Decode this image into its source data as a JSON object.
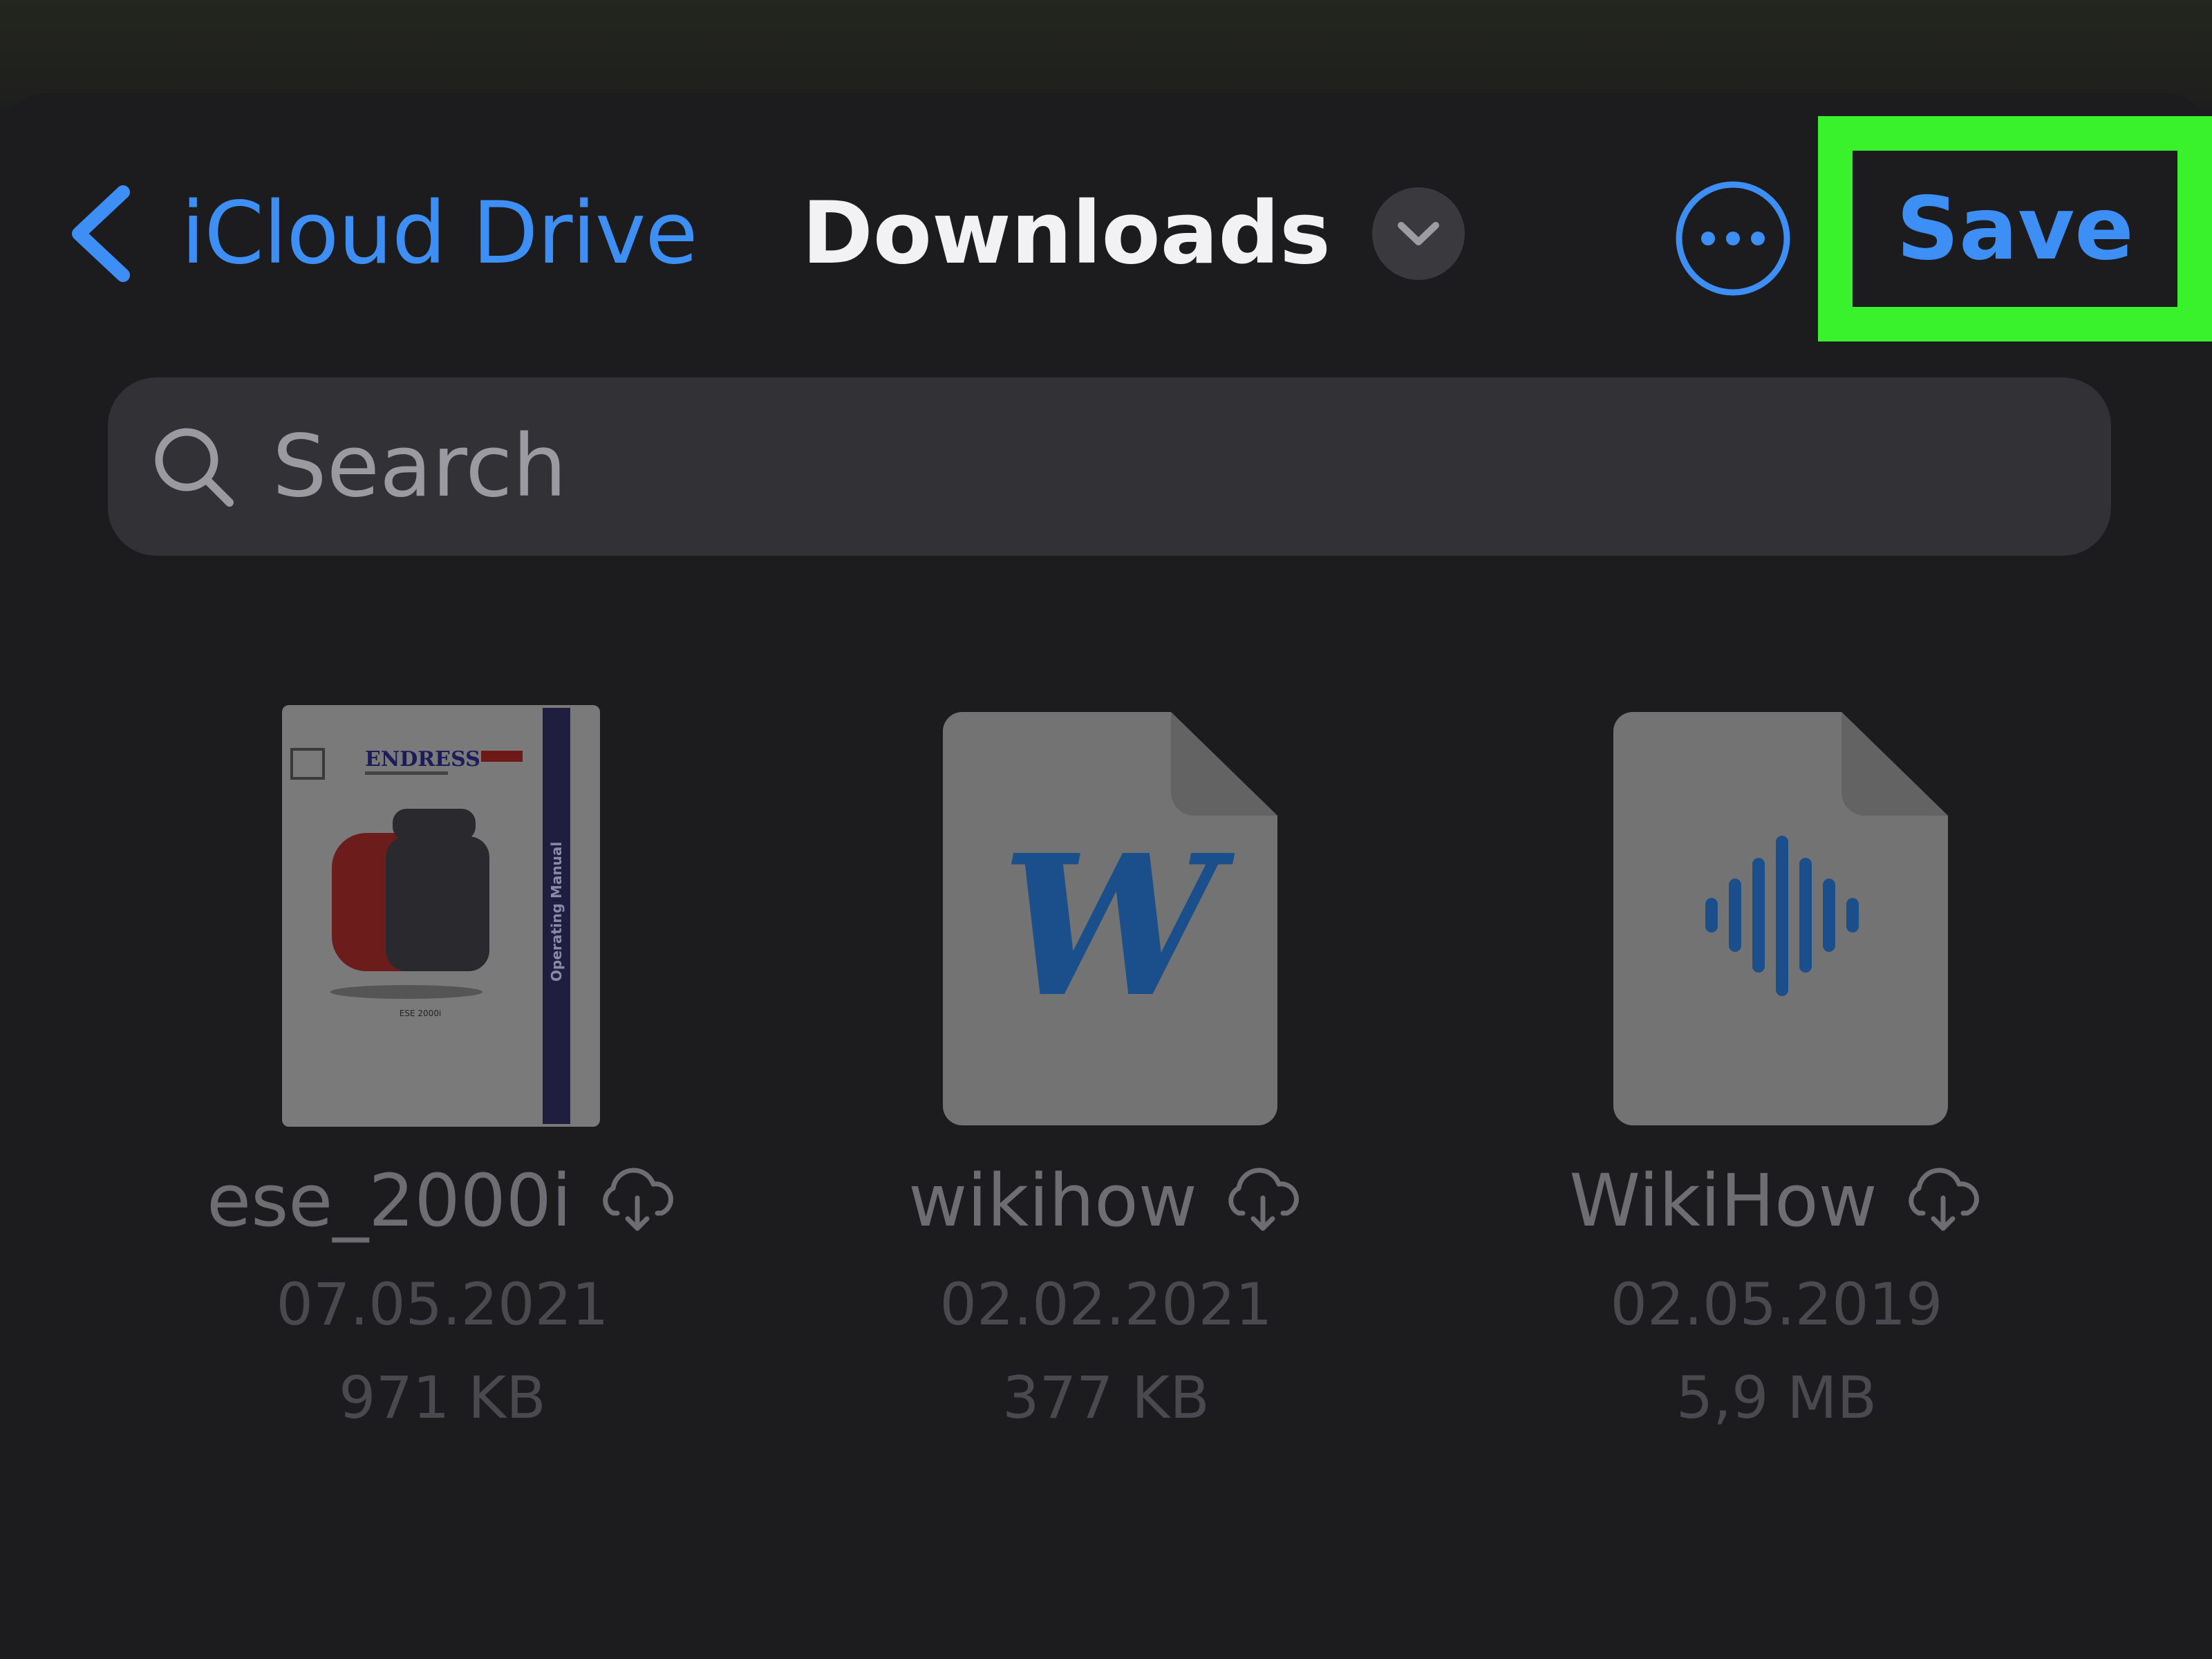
{
  "header": {
    "back_label": "iCloud Drive",
    "title": "Downloads",
    "save_label": "Save",
    "accent_color": "#3d8ff5",
    "highlight_color": "#39f22c"
  },
  "search": {
    "placeholder": "Search"
  },
  "files": [
    {
      "name": "ese_2000i",
      "date": "07.05.2021",
      "size": "971 KB",
      "type": "pdf-manual",
      "cover": {
        "brand": "ENDRESS",
        "side_text": "Operating Manual",
        "model": "ESE 2000i"
      }
    },
    {
      "name": "wikihow",
      "date": "02.02.2021",
      "size": "377 KB",
      "type": "word-document",
      "icon_glyph": "W"
    },
    {
      "name": "WikiHow",
      "date": "02.05.2019",
      "size": "5,9 MB",
      "type": "audio-file"
    }
  ]
}
